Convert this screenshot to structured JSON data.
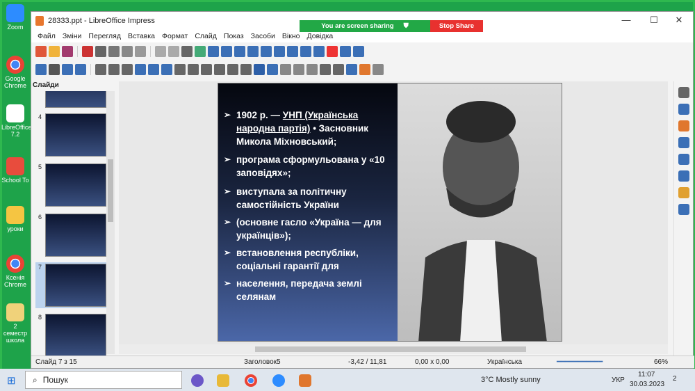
{
  "desktop_icons": [
    {
      "label": "Zoom"
    },
    {
      "label": "Google Chrome"
    },
    {
      "label": "LibreOffice 7.2"
    },
    {
      "label": "School To"
    },
    {
      "label": "уроки"
    },
    {
      "label": "Ксенія Chrome"
    },
    {
      "label": "2 семестр школа"
    }
  ],
  "window": {
    "title": "28333.ppt - LibreOffice Impress"
  },
  "menu": [
    "Файл",
    "Зміни",
    "Перегляд",
    "Вставка",
    "Формат",
    "Слайд",
    "Показ",
    "Засоби",
    "Вікно",
    "Довідка"
  ],
  "share": {
    "status": "You are screen sharing",
    "stop": "Stop Share"
  },
  "slides_panel": {
    "title": "Слайди",
    "numbers": [
      "4",
      "5",
      "6",
      "7",
      "8"
    ]
  },
  "slide": {
    "bullets": [
      {
        "pre": "1902 р. — ",
        "link": "УНП (Українська народна партія)",
        "post": " • Засновник Микола Міхновський;"
      },
      {
        "pre": "програма сформульована у «10 заповідях»;",
        "link": "",
        "post": ""
      },
      {
        "pre": "виступала за політичну самостійність України",
        "link": "",
        "post": ""
      },
      {
        "pre": "(основне гасло «Україна — для українців»);",
        "link": "",
        "post": ""
      },
      {
        "pre": "встановлення республіки, соціальні гарантії для",
        "link": "",
        "post": ""
      },
      {
        "pre": "населення, передача землі селянам",
        "link": "",
        "post": ""
      }
    ]
  },
  "status": {
    "slide": "Слайд 7 з 15",
    "layout": "Заголовок5",
    "position": "-3,42 / 11,81",
    "size": "0,00 x 0,00",
    "lang": "Українська",
    "zoom": "66%"
  },
  "taskbar": {
    "search": "Пошук",
    "weather": "3°C  Mostly sunny",
    "lang": "УКР",
    "time": "11:07",
    "date": "30.03.2023",
    "notif": "2"
  }
}
